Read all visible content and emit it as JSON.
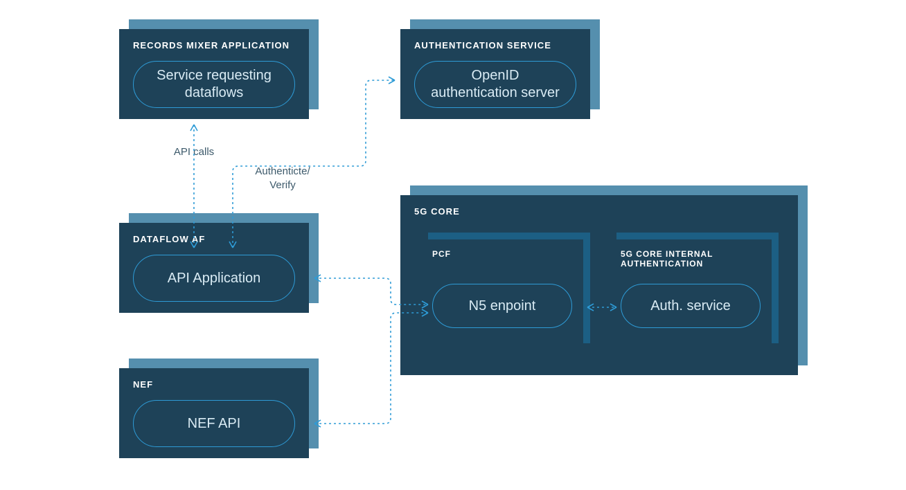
{
  "nodes": {
    "records_mixer": {
      "title": "RECORDS MIXER APPLICATION",
      "pill": "Service requesting dataflows"
    },
    "auth_service": {
      "title": "AUTHENTICATION SERVICE",
      "pill": "OpenID authentication server"
    },
    "dataflow_af": {
      "title": "DATAFLOW AF",
      "pill": "API Application"
    },
    "nef": {
      "title": "NEF",
      "pill": "NEF API"
    },
    "five_g_core": {
      "title": "5G CORE"
    },
    "pcf": {
      "title": "PCF",
      "pill": "N5 enpoint"
    },
    "core_auth": {
      "title": "5G CORE INTERNAL AUTHENTICATION",
      "pill": "Auth. service"
    }
  },
  "edges": {
    "api_calls": "API calls",
    "auth_verify": "Authenticte/\nVerify"
  }
}
